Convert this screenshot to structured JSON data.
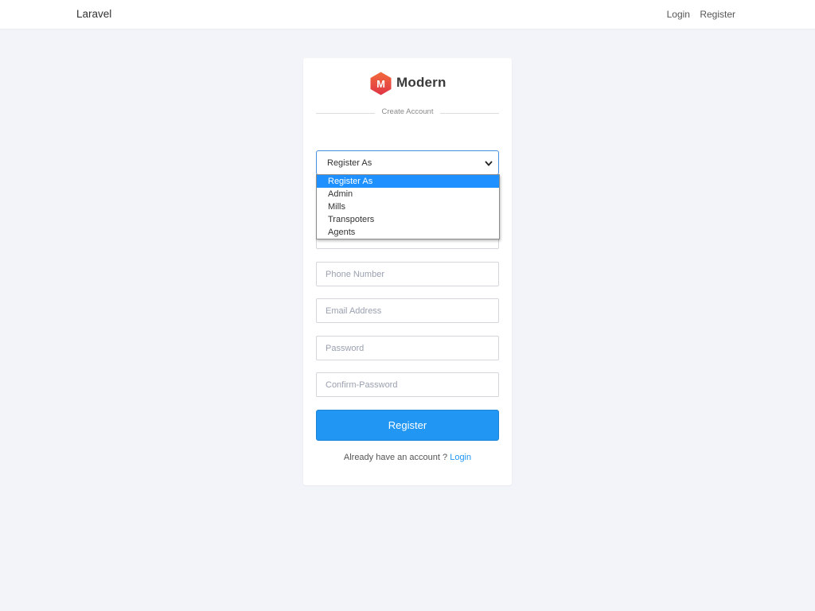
{
  "navbar": {
    "brand": "Laravel",
    "login": "Login",
    "register": "Register"
  },
  "card": {
    "logo_text": "Modern",
    "logo_letter": "M",
    "divider_text": "Create Account",
    "select": {
      "value": "Register As",
      "options": [
        "Register As",
        "Admin",
        "Mills",
        "Transpoters",
        "Agents"
      ]
    },
    "fields": {
      "phone_placeholder": "Phone Number",
      "email_placeholder": "Email Address",
      "password_placeholder": "Password",
      "confirm_placeholder": "Confirm-Password"
    },
    "submit_label": "Register",
    "footer_prefix": "Already have an account ?",
    "footer_link": "Login"
  },
  "colors": {
    "accent": "#2196f3",
    "logo": "#e84a3c",
    "background": "#f3f4f9"
  }
}
